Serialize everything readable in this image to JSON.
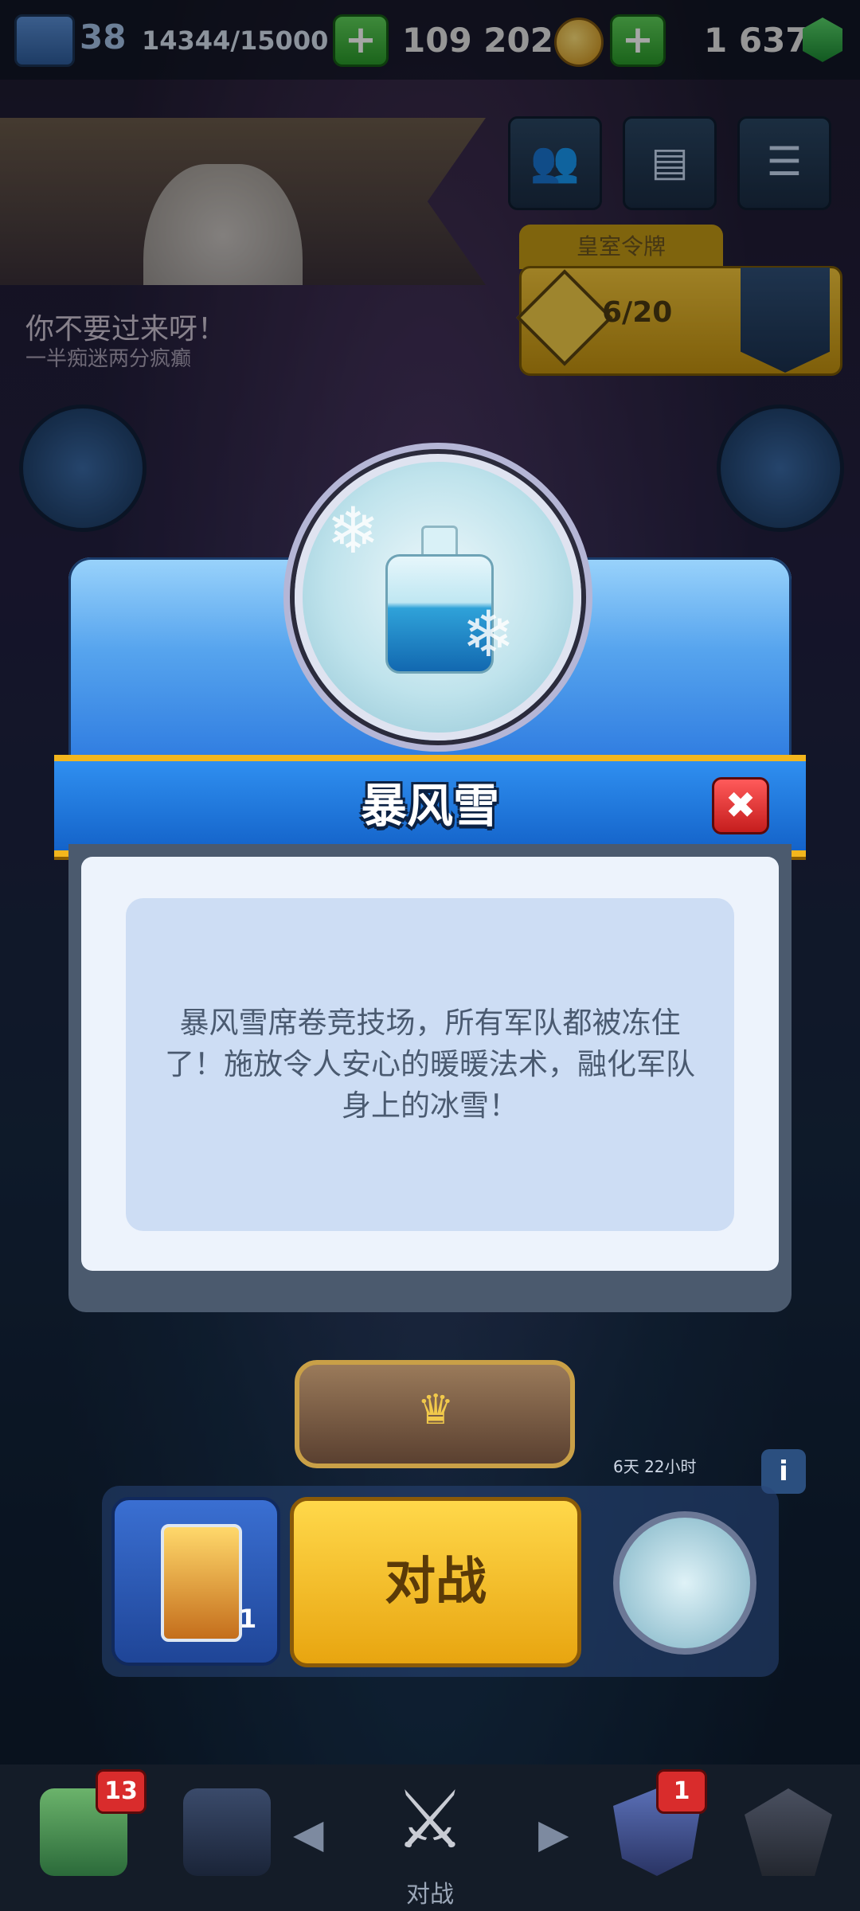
{
  "hud": {
    "level": "38",
    "xp": "14344/15000",
    "plus_label": "+",
    "gold": "109 202",
    "gems": "1 637"
  },
  "player": {
    "name": "你不要过来呀！",
    "clan": "一半痴迷两分疯癫"
  },
  "pass": {
    "tab_label": "皇室令牌",
    "progress": "6/20"
  },
  "modal": {
    "title": "暴风雪",
    "description": "暴风雪席卷竞技场，所有军队都被冻住了！施放令人安心的暖暖法术，融化军队身上的冰雪！",
    "close_label": "✖"
  },
  "battle": {
    "event_timer": "6天 22小时",
    "info_label": "i",
    "battle_label": "对战",
    "deck_count": "1"
  },
  "bottom_nav": {
    "shop_badge": "13",
    "clan_badge": "1",
    "battle_label": "对战"
  },
  "icons": {
    "coin": "coin-icon",
    "gem": "gem-icon",
    "close": "close-icon",
    "crown": "crown-icon",
    "snowflake": "snowflake-icon",
    "bottle": "bottle-icon"
  },
  "colors": {
    "title_band": "#1f7be0",
    "title_trim": "#f3b61d",
    "battle_button": "#f5c226",
    "close_button": "#d92c2c"
  }
}
